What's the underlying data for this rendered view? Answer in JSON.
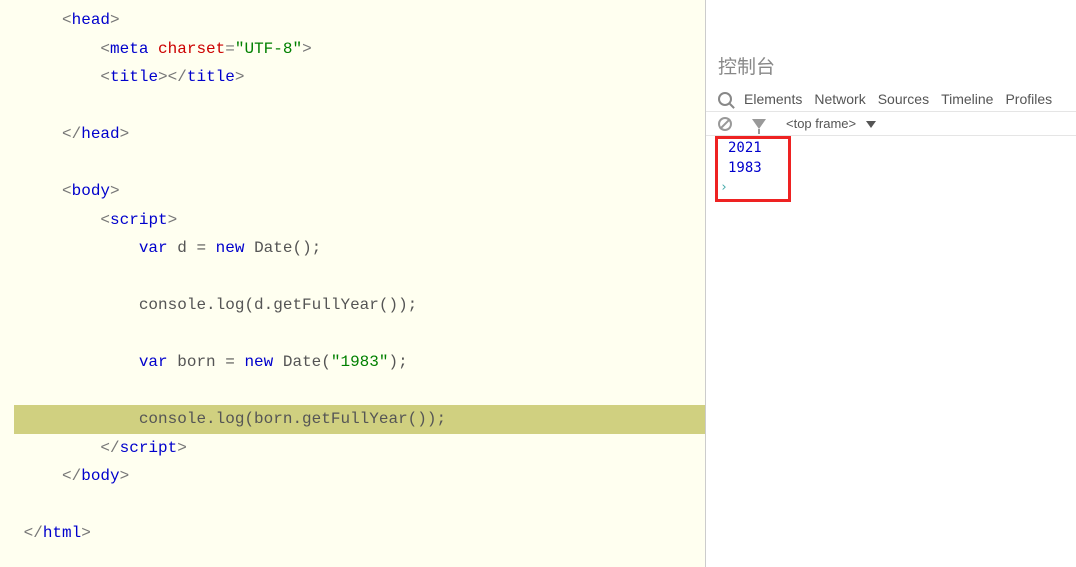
{
  "editor": {
    "lines": [
      {
        "indent": 1,
        "tokens": [
          {
            "t": "bracket",
            "v": "<"
          },
          {
            "t": "tag",
            "v": "head"
          },
          {
            "t": "bracket",
            "v": ">"
          }
        ]
      },
      {
        "indent": 2,
        "tokens": [
          {
            "t": "bracket",
            "v": "<"
          },
          {
            "t": "tag",
            "v": "meta"
          },
          {
            "t": "plain",
            "v": " "
          },
          {
            "t": "attr",
            "v": "charset"
          },
          {
            "t": "eq",
            "v": "="
          },
          {
            "t": "string",
            "v": "\"UTF-8\""
          },
          {
            "t": "bracket",
            "v": ">"
          }
        ]
      },
      {
        "indent": 2,
        "tokens": [
          {
            "t": "bracket",
            "v": "<"
          },
          {
            "t": "tag",
            "v": "title"
          },
          {
            "t": "bracket",
            "v": "></"
          },
          {
            "t": "tag",
            "v": "title"
          },
          {
            "t": "bracket",
            "v": ">"
          }
        ]
      },
      {
        "indent": 0,
        "tokens": []
      },
      {
        "indent": 1,
        "tokens": [
          {
            "t": "bracket",
            "v": "</"
          },
          {
            "t": "tag",
            "v": "head"
          },
          {
            "t": "bracket",
            "v": ">"
          }
        ]
      },
      {
        "indent": 0,
        "tokens": []
      },
      {
        "indent": 1,
        "tokens": [
          {
            "t": "bracket",
            "v": "<"
          },
          {
            "t": "tag",
            "v": "body"
          },
          {
            "t": "bracket",
            "v": ">"
          }
        ]
      },
      {
        "indent": 2,
        "tokens": [
          {
            "t": "bracket",
            "v": "<"
          },
          {
            "t": "tag",
            "v": "script"
          },
          {
            "t": "bracket",
            "v": ">"
          }
        ]
      },
      {
        "indent": 3,
        "tokens": [
          {
            "t": "jskeyword",
            "v": "var"
          },
          {
            "t": "plain",
            "v": " d = "
          },
          {
            "t": "jskeyword",
            "v": "new"
          },
          {
            "t": "plain",
            "v": " Date();"
          }
        ]
      },
      {
        "indent": 0,
        "tokens": []
      },
      {
        "indent": 3,
        "tokens": [
          {
            "t": "plain",
            "v": "console.log(d.getFullYear());"
          }
        ]
      },
      {
        "indent": 0,
        "tokens": []
      },
      {
        "indent": 3,
        "tokens": [
          {
            "t": "jskeyword",
            "v": "var"
          },
          {
            "t": "plain",
            "v": " born = "
          },
          {
            "t": "jskeyword",
            "v": "new"
          },
          {
            "t": "plain",
            "v": " Date("
          },
          {
            "t": "strlit",
            "v": "\"1983\""
          },
          {
            "t": "plain",
            "v": ");"
          }
        ]
      },
      {
        "indent": 0,
        "tokens": []
      },
      {
        "indent": 3,
        "highlighted": true,
        "tokens": [
          {
            "t": "plain",
            "v": "console.log(born.getFullYear());"
          }
        ]
      },
      {
        "indent": 2,
        "tokens": [
          {
            "t": "bracket",
            "v": "</"
          },
          {
            "t": "tag",
            "v": "script"
          },
          {
            "t": "bracket",
            "v": ">"
          }
        ]
      },
      {
        "indent": 1,
        "tokens": [
          {
            "t": "bracket",
            "v": "</"
          },
          {
            "t": "tag",
            "v": "body"
          },
          {
            "t": "bracket",
            "v": ">"
          }
        ]
      },
      {
        "indent": 0,
        "tokens": []
      },
      {
        "indent": 0,
        "tokens": [
          {
            "t": "bracket",
            "v": "</"
          },
          {
            "t": "tag",
            "v": "html"
          },
          {
            "t": "bracket",
            "v": ">"
          }
        ]
      }
    ]
  },
  "devtools": {
    "title": "控制台",
    "tabs": [
      "Elements",
      "Network",
      "Sources",
      "Timeline",
      "Profiles"
    ],
    "frame_label": "<top frame>",
    "console_values": [
      "2021",
      "1983"
    ]
  }
}
